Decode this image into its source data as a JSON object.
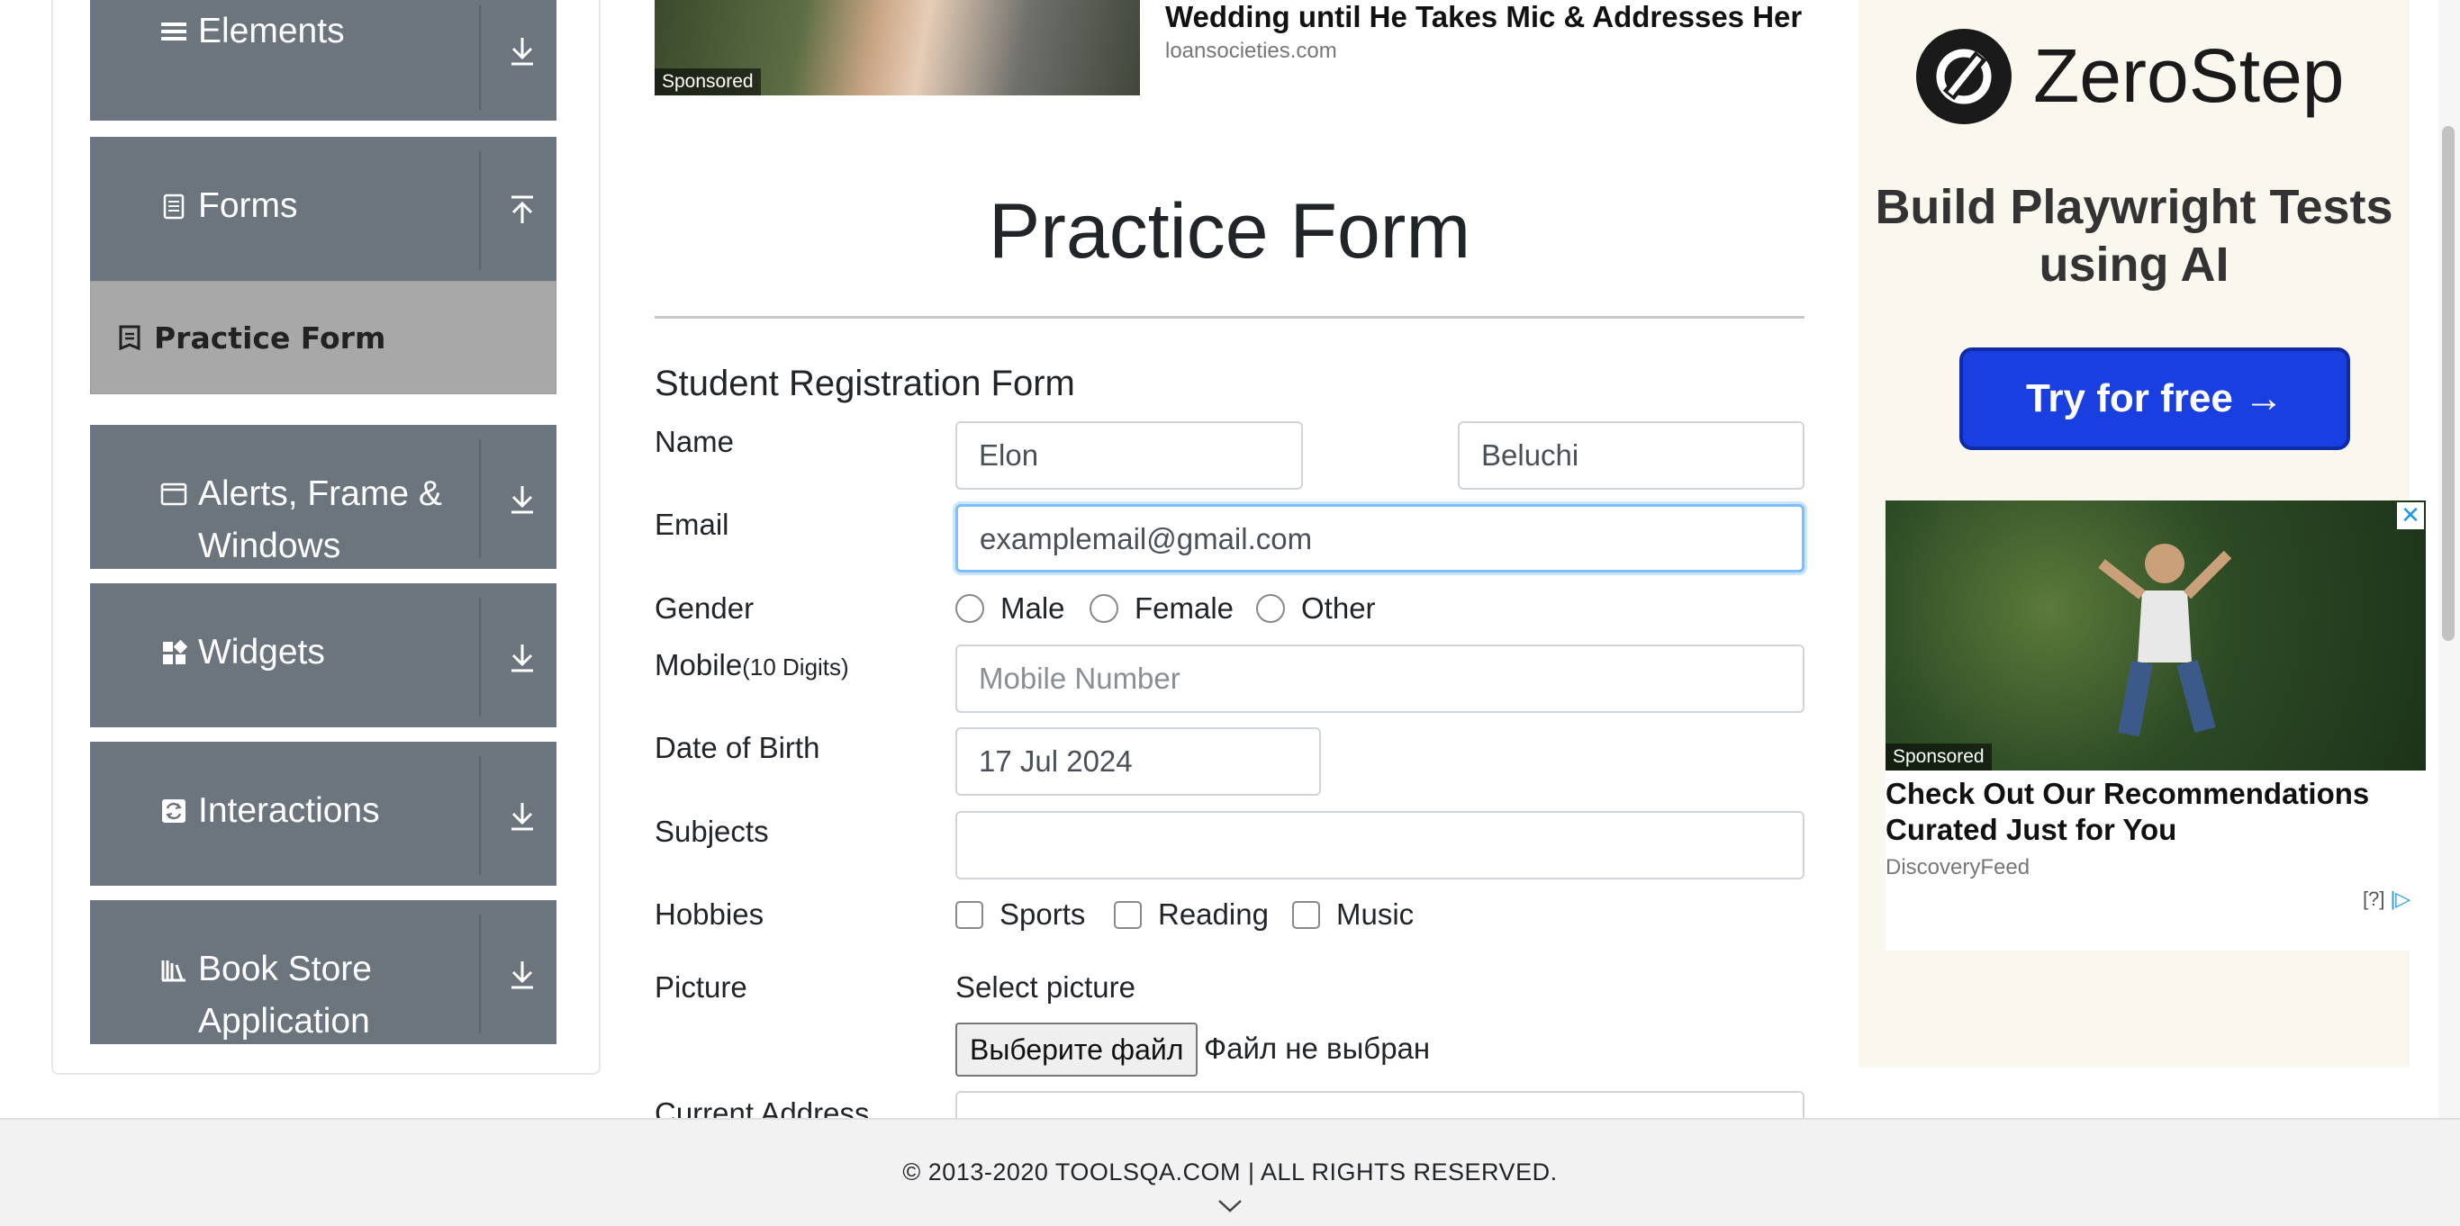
{
  "sidebar": {
    "groups": [
      {
        "label": "Elements",
        "icon": "list-icon",
        "arrow": "download"
      },
      {
        "label": "Forms",
        "icon": "document-icon",
        "arrow": "upload"
      },
      {
        "label": "Alerts, Frame &\nWindows",
        "icon": "window-icon",
        "arrow": "download"
      },
      {
        "label": "Widgets",
        "icon": "widgets-icon",
        "arrow": "download"
      },
      {
        "label": "Interactions",
        "icon": "interactions-icon",
        "arrow": "download"
      },
      {
        "label": "Book Store\nApplication",
        "icon": "books-icon",
        "arrow": "download"
      }
    ],
    "forms_subitem": "Practice Form"
  },
  "ad_top": {
    "title": "Wedding until He Takes Mic & Addresses Her",
    "source": "loansocieties.com",
    "tag": "Sponsored"
  },
  "page_title": "Practice Form",
  "form": {
    "title": "Student Registration Form",
    "name_label": "Name",
    "first_name": "Elon",
    "last_name": "Beluchi",
    "email_label": "Email",
    "email": "examplemail@gmail.com",
    "gender_label": "Gender",
    "genders": [
      "Male",
      "Female",
      "Other"
    ],
    "mobile_label": "Mobile",
    "mobile_hint": "(10 Digits)",
    "mobile_placeholder": "Mobile Number",
    "dob_label": "Date of Birth",
    "dob": "17 Jul 2024",
    "subjects_label": "Subjects",
    "hobbies_label": "Hobbies",
    "hobbies": [
      "Sports",
      "Reading",
      "Music"
    ],
    "picture_label": "Picture",
    "select_picture": "Select picture",
    "file_button": "Выберите файл",
    "file_status": "Файл не выбран",
    "address_label": "Current Address"
  },
  "ad_right": {
    "brand": "ZeroStep",
    "tagline": "Build Playwright Tests using AI",
    "cta": "Try for free →",
    "card_tag": "Sponsored",
    "card_title": "Check Out Our Recommendations Curated Just for You",
    "card_source": "DiscoveryFeed",
    "adchoice": "[?]"
  },
  "footer": {
    "text": "© 2013-2020 TOOLSQA.COM | ALL RIGHTS RESERVED."
  },
  "colors": {
    "sidebar_bg": "#6c757d",
    "subitem_bg": "#a8a8a8",
    "cta_blue": "#1a3fe0",
    "focus_border": "#80bdff"
  }
}
